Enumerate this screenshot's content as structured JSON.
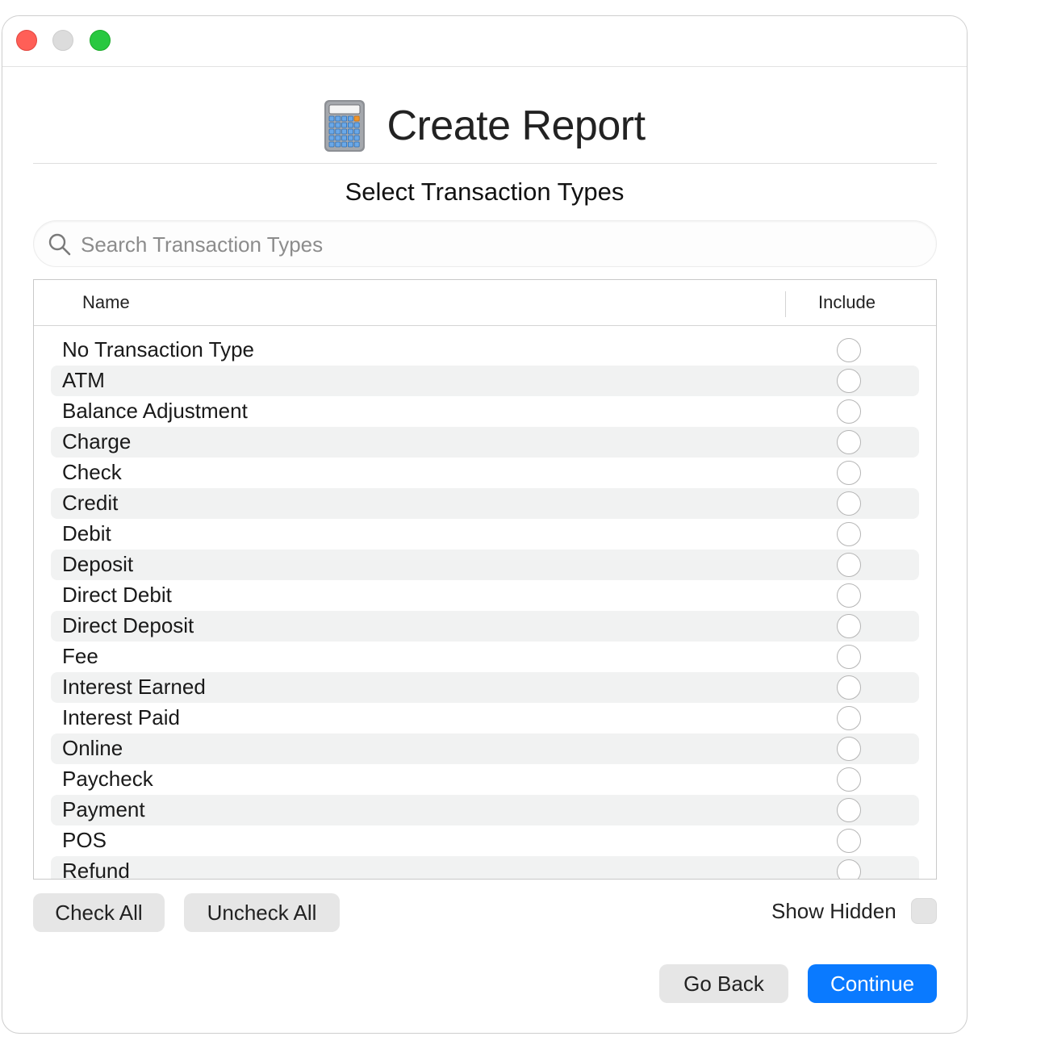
{
  "window": {
    "controls": [
      "close",
      "minimize",
      "zoom"
    ]
  },
  "header": {
    "icon": "calculator-icon",
    "title": "Create Report"
  },
  "subtitle": "Select Transaction Types",
  "search": {
    "placeholder": "Search Transaction Types",
    "value": ""
  },
  "table": {
    "columns": [
      "Name",
      "Include"
    ],
    "rows": [
      {
        "name": "No Transaction Type",
        "include": false
      },
      {
        "name": "ATM",
        "include": false
      },
      {
        "name": "Balance Adjustment",
        "include": false
      },
      {
        "name": "Charge",
        "include": false
      },
      {
        "name": "Check",
        "include": false
      },
      {
        "name": "Credit",
        "include": false
      },
      {
        "name": "Debit",
        "include": false
      },
      {
        "name": "Deposit",
        "include": false
      },
      {
        "name": "Direct Debit",
        "include": false
      },
      {
        "name": "Direct Deposit",
        "include": false
      },
      {
        "name": "Fee",
        "include": false
      },
      {
        "name": "Interest Earned",
        "include": false
      },
      {
        "name": "Interest Paid",
        "include": false
      },
      {
        "name": "Online",
        "include": false
      },
      {
        "name": "Paycheck",
        "include": false
      },
      {
        "name": "Payment",
        "include": false
      },
      {
        "name": "POS",
        "include": false
      },
      {
        "name": "Refund",
        "include": false
      }
    ]
  },
  "actions": {
    "check_all": "Check All",
    "uncheck_all": "Uncheck All",
    "show_hidden": "Show Hidden",
    "show_hidden_checked": false,
    "go_back": "Go Back",
    "continue": "Continue"
  },
  "colors": {
    "accent": "#0a7aff",
    "close": "#ff5f57",
    "minimize": "#dcdcdc",
    "zoom": "#28c840",
    "row_alt": "#f1f2f2"
  }
}
